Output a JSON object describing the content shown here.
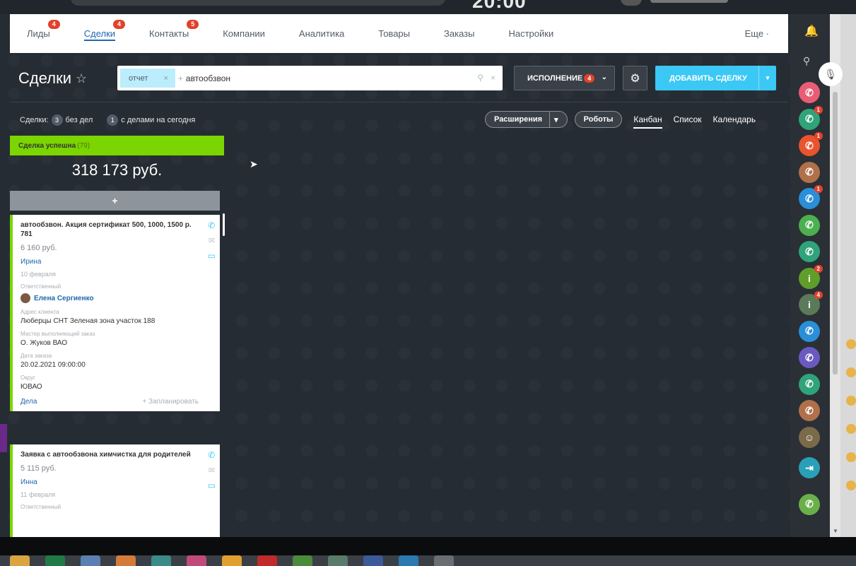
{
  "browser": {
    "clock": "20:00"
  },
  "nav": {
    "items": [
      {
        "label": "Лиды",
        "badge": "4",
        "active": false
      },
      {
        "label": "Сделки",
        "badge": "4",
        "active": true
      },
      {
        "label": "Контакты",
        "badge": "5",
        "active": false
      },
      {
        "label": "Компании",
        "badge": "",
        "active": false
      },
      {
        "label": "Аналитика",
        "badge": "",
        "active": false
      },
      {
        "label": "Товары",
        "badge": "",
        "active": false
      },
      {
        "label": "Заказы",
        "badge": "",
        "active": false
      },
      {
        "label": "Настройки",
        "badge": "",
        "active": false
      }
    ],
    "more": "Еще ·"
  },
  "page": {
    "title": "Сделки",
    "star": "☆"
  },
  "filter": {
    "chip": "отчет",
    "chip_close": "×",
    "plus": "+",
    "text": "автообзвон",
    "search_icon": "⚲",
    "clear_icon": "×"
  },
  "toolbar": {
    "exec_label": "исполнение",
    "exec_badge": "4",
    "exec_chevron": "⌄",
    "gear": "⚙",
    "add_label": "добавить сделку",
    "add_arrow": "▾"
  },
  "counters": {
    "deals_label": "Сделки:",
    "no_deals_count": "3",
    "no_deals_label": "без дел",
    "today_count": "1",
    "today_label": "с делами на сегодня"
  },
  "views": {
    "extensions": "Расширения",
    "extensions_arrow": "▾",
    "robots": "Роботы",
    "kanban": "Канбан",
    "list": "Список",
    "calendar": "Календарь"
  },
  "stage": {
    "name": "Сделка успешна",
    "count": "(79)",
    "sum": "318 173 руб.",
    "add": "+",
    "color": "#7bd500"
  },
  "cards": [
    {
      "title": "автообзвон. Акция сертификат 500, 1000, 1500 р. 781",
      "price": "6 160 руб.",
      "contact": "Ирина",
      "date": "10 февраля",
      "responsible_label": "Ответственный",
      "responsible": "Елена Сергиенко",
      "address_label": "Адрес клиента",
      "address": "Люберцы СНТ Зеленая зона участок 188",
      "master_label": "Мастер выполняющий заказ",
      "master": "О. Жуков ВАО",
      "order_date_label": "Дата заказа",
      "order_date": "20.02.2021 09:00:00",
      "district_label": "Округ",
      "district": "ЮВАО",
      "deals": "Дела",
      "plan": "+ Запланировать"
    },
    {
      "title": "Заявка с автообзвона химчистка для родителей",
      "price": "5 115 руб.",
      "contact": "Инна",
      "date": "11 февраля",
      "responsible_label": "Ответственный"
    }
  ],
  "card_icons": {
    "phone": "✆",
    "mail": "✉",
    "chat": "▭"
  },
  "rightbar": {
    "bell": "🔔",
    "search": "⚲",
    "mic": "🎙",
    "contacts": [
      {
        "color": "#e85d75",
        "glyph": "✆",
        "badge": ""
      },
      {
        "color": "#2fa37a",
        "glyph": "✆",
        "badge": "1"
      },
      {
        "color": "#e8542e",
        "glyph": "✆",
        "badge": "1"
      },
      {
        "color": "#b0704a",
        "glyph": "✆",
        "badge": ""
      },
      {
        "color": "#2a8ed8",
        "glyph": "✆",
        "badge": "1"
      },
      {
        "color": "#4caf50",
        "glyph": "✆",
        "badge": ""
      },
      {
        "color": "#2fa37a",
        "glyph": "✆",
        "badge": ""
      },
      {
        "color": "#5f9e2a",
        "glyph": "i",
        "badge": "2"
      },
      {
        "color": "#5a7a5a",
        "glyph": "i",
        "badge": "4"
      },
      {
        "color": "#2a8ed8",
        "glyph": "✆",
        "badge": ""
      },
      {
        "color": "#6a5ac0",
        "glyph": "✆",
        "badge": ""
      },
      {
        "color": "#2fa37a",
        "glyph": "✆",
        "badge": ""
      },
      {
        "color": "#b0704a",
        "glyph": "✆",
        "badge": ""
      },
      {
        "color": "#7a6a4a",
        "glyph": "☺",
        "badge": ""
      },
      {
        "color": "#2a9fb8",
        "glyph": "⇥",
        "badge": ""
      },
      {
        "color": "#6ab04a",
        "glyph": "✆",
        "badge": ""
      }
    ]
  },
  "taskbar": {
    "icons": [
      {
        "name": "file-explorer-icon",
        "color": "#d9a441"
      },
      {
        "name": "excel-icon",
        "color": "#1f7a45"
      },
      {
        "name": "document-icon",
        "color": "#5a7fb0"
      },
      {
        "name": "folder-icon",
        "color": "#d47a3a"
      },
      {
        "name": "app-icon",
        "color": "#3a8a8a"
      },
      {
        "name": "browser-icon",
        "color": "#c04a7a"
      },
      {
        "name": "paint-icon",
        "color": "#e0a030"
      },
      {
        "name": "opera-icon",
        "color": "#c02a2a"
      },
      {
        "name": "app-green-icon",
        "color": "#4a8a3a"
      },
      {
        "name": "mail-icon",
        "color": "#5a7a6a"
      },
      {
        "name": "window-icon",
        "color": "#3a5a9a"
      },
      {
        "name": "skype-icon",
        "color": "#2a7ab0"
      },
      {
        "name": "app-gray-icon",
        "color": "#6a6e72"
      }
    ]
  }
}
